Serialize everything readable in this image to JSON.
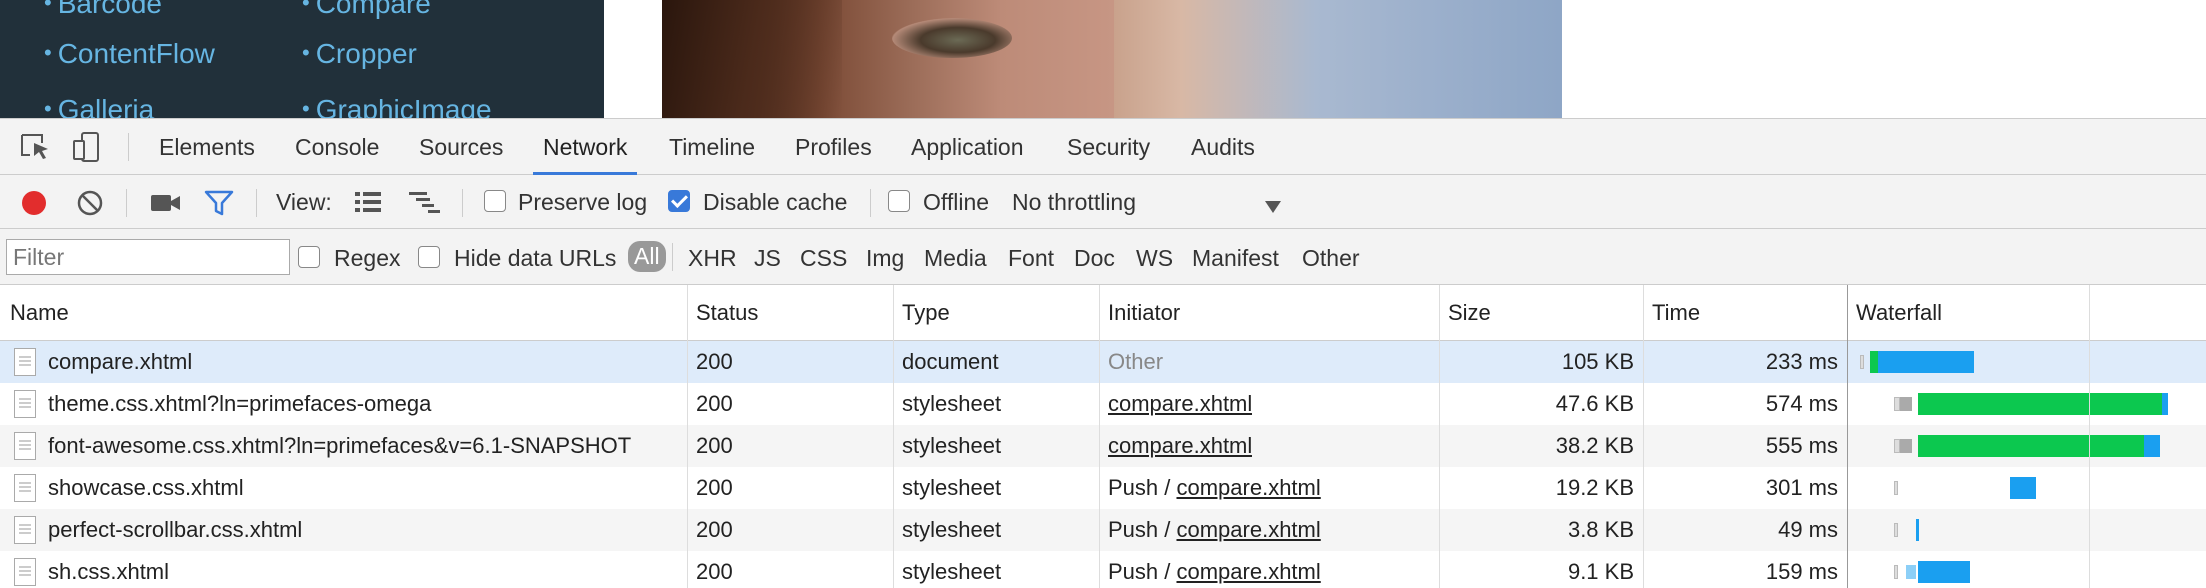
{
  "page": {
    "nav_col1": [
      "Barcode",
      "ContentFlow",
      "Galleria"
    ],
    "nav_col2": [
      "Compare",
      "Cropper",
      "GraphicImage"
    ]
  },
  "devtools": {
    "tabs": [
      "Elements",
      "Console",
      "Sources",
      "Network",
      "Timeline",
      "Profiles",
      "Application",
      "Security",
      "Audits"
    ],
    "active_tab": "Network",
    "toolbar": {
      "view_label": "View:",
      "preserve_log": "Preserve log",
      "disable_cache": "Disable cache",
      "offline": "Offline",
      "throttling": "No throttling",
      "preserve_log_checked": false,
      "disable_cache_checked": true,
      "offline_checked": false
    },
    "filterbar": {
      "filter_placeholder": "Filter",
      "regex": "Regex",
      "hide_data_urls": "Hide data URLs",
      "types": [
        "All",
        "XHR",
        "JS",
        "CSS",
        "Img",
        "Media",
        "Font",
        "Doc",
        "WS",
        "Manifest",
        "Other"
      ],
      "active_type": "All"
    },
    "columns": [
      "Name",
      "Status",
      "Type",
      "Initiator",
      "Size",
      "Time",
      "Waterfall"
    ],
    "rows": [
      {
        "name": "compare.xhtml",
        "status": "200",
        "type": "document",
        "initiator_prefix": "",
        "initiator_link": "",
        "initiator_text": "Other",
        "size": "105 KB",
        "time": "233 ms"
      },
      {
        "name": "theme.css.xhtml?ln=primefaces-omega",
        "status": "200",
        "type": "stylesheet",
        "initiator_prefix": "",
        "initiator_link": "compare.xhtml",
        "initiator_text": "",
        "size": "47.6 KB",
        "time": "574 ms"
      },
      {
        "name": "font-awesome.css.xhtml?ln=primefaces&v=6.1-SNAPSHOT",
        "status": "200",
        "type": "stylesheet",
        "initiator_prefix": "",
        "initiator_link": "compare.xhtml",
        "initiator_text": "",
        "size": "38.2 KB",
        "time": "555 ms"
      },
      {
        "name": "showcase.css.xhtml",
        "status": "200",
        "type": "stylesheet",
        "initiator_prefix": "Push / ",
        "initiator_link": "compare.xhtml",
        "initiator_text": "",
        "size": "19.2 KB",
        "time": "301 ms"
      },
      {
        "name": "perfect-scrollbar.css.xhtml",
        "status": "200",
        "type": "stylesheet",
        "initiator_prefix": "Push / ",
        "initiator_link": "compare.xhtml",
        "initiator_text": "",
        "size": "3.8 KB",
        "time": "49 ms"
      },
      {
        "name": "sh.css.xhtml",
        "status": "200",
        "type": "stylesheet",
        "initiator_prefix": "Push / ",
        "initiator_link": "compare.xhtml",
        "initiator_text": "",
        "size": "9.1 KB",
        "time": "159 ms"
      }
    ],
    "colors": {
      "record": "#e22d2d",
      "accent": "#3879d9",
      "waterfall_download": "#1a9ff0",
      "waterfall_waiting": "#0cc84f",
      "selected_row": "#deebfa"
    }
  }
}
